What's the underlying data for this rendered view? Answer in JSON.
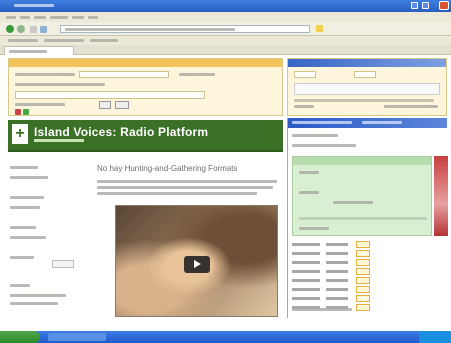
{
  "window": {
    "title": ""
  },
  "colors": {
    "brand_green": "#3b7126",
    "title_blue": "#2a5fc0",
    "panel_yellow": "#fdf6dd",
    "dock_green": "#d8efd2"
  },
  "banner": {
    "title": "Island Voices: Radio Platform",
    "icon": "plus-logo-icon"
  },
  "article": {
    "headline": "No hay Hunting-and-Gathering Formats",
    "video_control": "play-icon"
  },
  "taskbar": {
    "start": "start-button"
  }
}
